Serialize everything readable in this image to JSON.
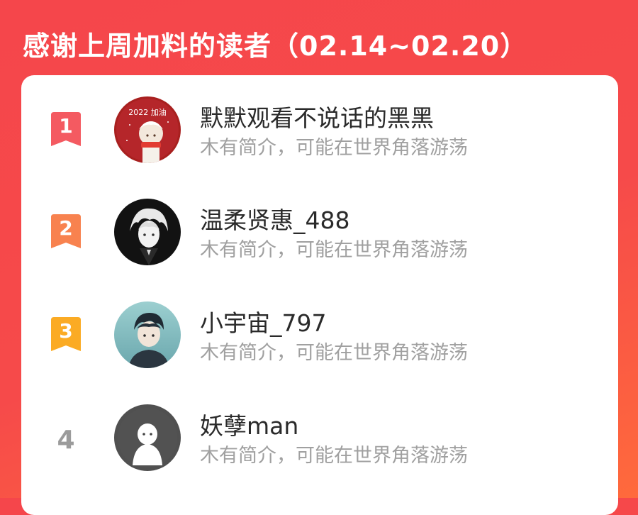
{
  "header": {
    "title": "感谢上周加料的读者（02.14~02.20）"
  },
  "readers": [
    {
      "rank": "1",
      "name": "默默观看不说话的黑黑",
      "bio": "木有简介，可能在世界角落游荡",
      "badge_color": "#f45a61"
    },
    {
      "rank": "2",
      "name": "温柔贤惠_488",
      "bio": "木有简介，可能在世界角落游荡",
      "badge_color": "#f8824f"
    },
    {
      "rank": "3",
      "name": "小宇宙_797",
      "bio": "木有简介，可能在世界角落游荡",
      "badge_color": "#fbab24"
    },
    {
      "rank": "4",
      "name": "妖孽man",
      "bio": "木有简介，可能在世界角落游荡"
    }
  ],
  "avatar_1_text": "2022 加油"
}
